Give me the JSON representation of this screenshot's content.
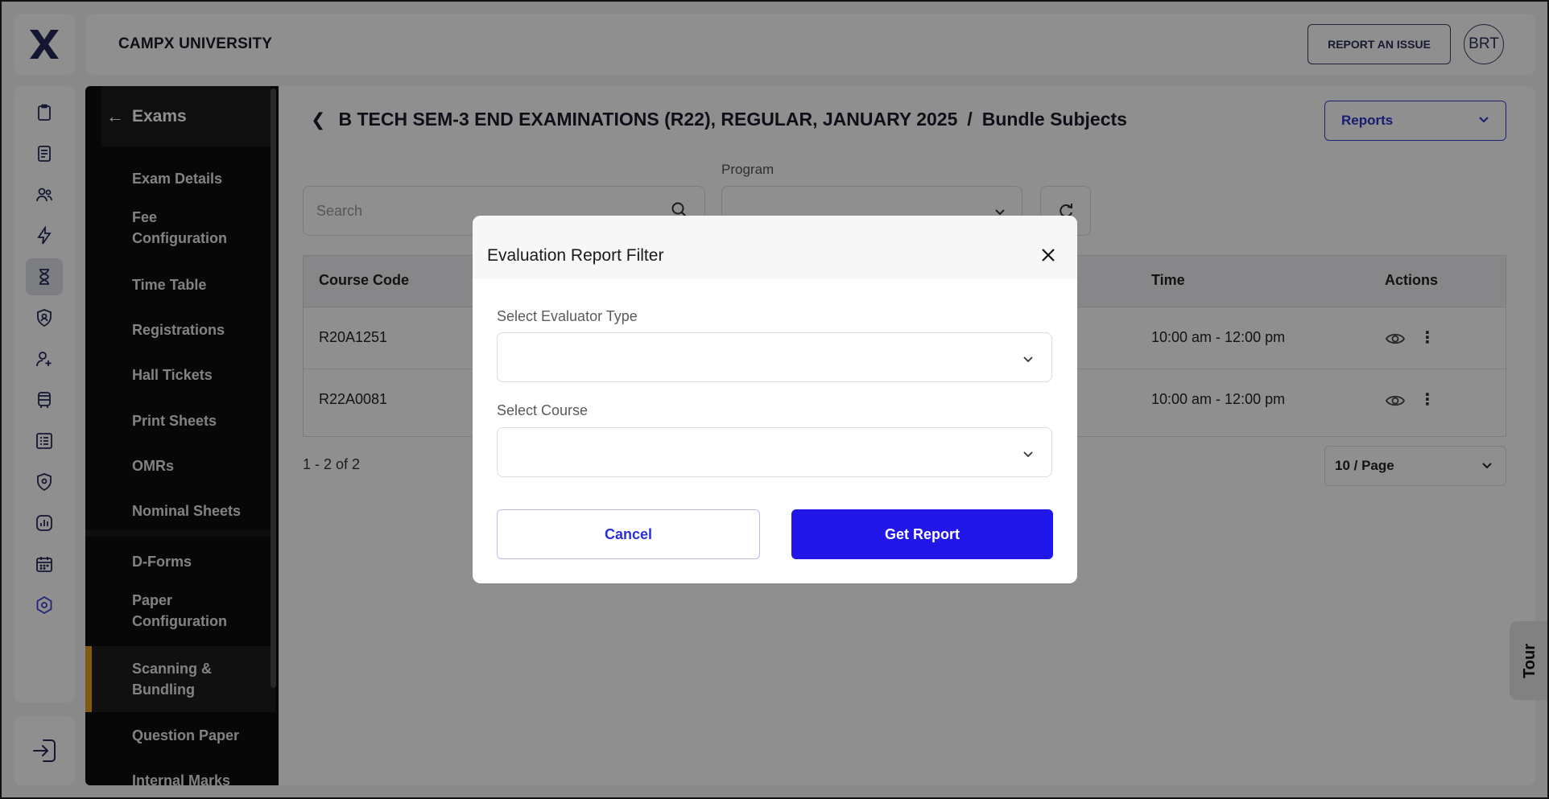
{
  "header": {
    "brand": "CAMPX UNIVERSITY",
    "report_issue_label": "REPORT AN ISSUE",
    "avatar_initials": "BRT"
  },
  "sidebar": {
    "title": "Exams",
    "items": [
      {
        "label": "Exam Details"
      },
      {
        "label": "Fee Configuration"
      },
      {
        "label": "Time Table"
      },
      {
        "label": "Registrations"
      },
      {
        "label": "Hall Tickets"
      },
      {
        "label": "Print Sheets"
      },
      {
        "label": "OMRs"
      },
      {
        "label": "Nominal Sheets"
      },
      {
        "label": "D-Forms"
      },
      {
        "label": "Paper Configuration"
      },
      {
        "label": "Scanning & Bundling"
      },
      {
        "label": "Question Paper"
      },
      {
        "label": "Internal Marks"
      }
    ],
    "active_index": 10
  },
  "main": {
    "breadcrumb_exam": "B TECH SEM-3 END EXAMINATIONS (R22), REGULAR, JANUARY 2025",
    "breadcrumb_separator": "/",
    "breadcrumb_page": "Bundle Subjects",
    "reports_label": "Reports",
    "search_placeholder": "Search",
    "program_label": "Program",
    "table": {
      "columns": [
        "Course Code",
        "Time",
        "Actions"
      ],
      "rows": [
        {
          "course_code": "R20A1251",
          "time": "10:00 am - 12:00 pm"
        },
        {
          "course_code": "R22A0081",
          "time": "10:00 am - 12:00 pm"
        }
      ]
    },
    "pagination_text": "1 - 2 of 2",
    "page_size": "10 / Page"
  },
  "tour_label": "Tour",
  "modal": {
    "title": "Evaluation Report Filter",
    "evaluator_label": "Select Evaluator Type",
    "evaluator_value": "",
    "course_label": "Select Course",
    "course_value": "",
    "cancel_label": "Cancel",
    "get_report_label": "Get Report"
  },
  "colors": {
    "primary": "#2117e8",
    "sidebar_bg": "#0d0d0d",
    "active_accent": "#e0a21a",
    "overlay": "rgba(0,0,0,0.44)"
  }
}
